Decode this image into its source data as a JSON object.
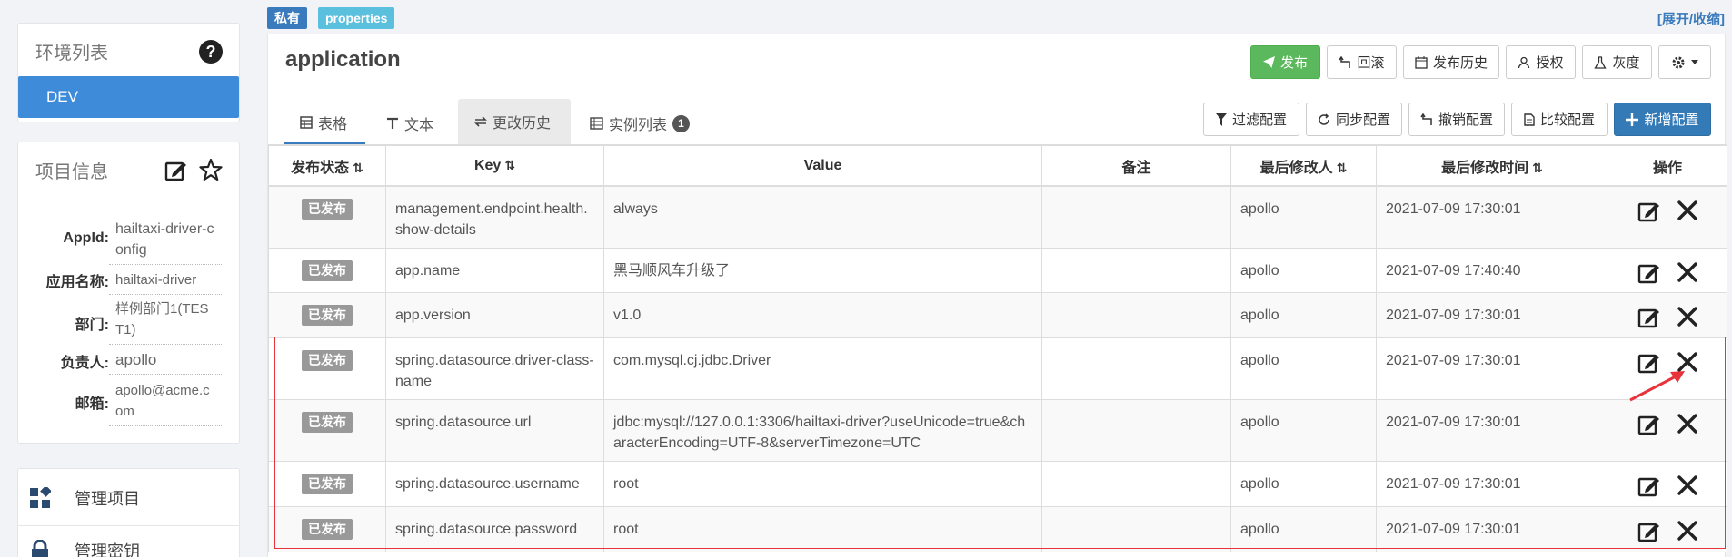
{
  "sidebar": {
    "env_title": "环境列表",
    "env_items": [
      "DEV"
    ],
    "info_title": "项目信息",
    "info": [
      {
        "label": "AppId:",
        "value": "hailtaxi-driver-config"
      },
      {
        "label": "应用名称:",
        "value": "hailtaxi-driver"
      },
      {
        "label": "部门:",
        "value": "样例部门1(TEST1)"
      },
      {
        "label": "负责人:",
        "value": "apollo"
      },
      {
        "label": "邮箱:",
        "value": "apollo@acme.com"
      }
    ],
    "manage": [
      {
        "label": "管理项目",
        "icon": "grid-icon"
      },
      {
        "label": "管理密钥",
        "icon": "lock-icon"
      }
    ]
  },
  "namespace": {
    "tag_private": "私有",
    "tag_format": "properties",
    "expand_label": "[展开/收缩]",
    "title": "application"
  },
  "toolbar": {
    "publish": "发布",
    "rollback": "回滚",
    "history": "发布历史",
    "authorize": "授权",
    "gray": "灰度"
  },
  "tabs": [
    {
      "label": "表格",
      "icon": "table-icon"
    },
    {
      "label": "文本",
      "icon": "text-icon"
    },
    {
      "label": "更改历史",
      "icon": "exchange-icon"
    },
    {
      "label": "实例列表",
      "icon": "list-icon",
      "badge": "1"
    }
  ],
  "actions": {
    "filter": "过滤配置",
    "sync": "同步配置",
    "revoke": "撤销配置",
    "compare": "比较配置",
    "add": "新增配置"
  },
  "table": {
    "headers": [
      "发布状态",
      "Key",
      "Value",
      "备注",
      "最后修改人",
      "最后修改时间",
      "操作"
    ],
    "rows": [
      {
        "status": "已发布",
        "key": "management.endpoint.health.show-details",
        "value": "always",
        "comment": "",
        "modifier": "apollo",
        "time": "2021-07-09 17:30:01"
      },
      {
        "status": "已发布",
        "key": "app.name",
        "value": "黑马顺风车升级了",
        "comment": "",
        "modifier": "apollo",
        "time": "2021-07-09 17:40:40"
      },
      {
        "status": "已发布",
        "key": "app.version",
        "value": "v1.0",
        "comment": "",
        "modifier": "apollo",
        "time": "2021-07-09 17:30:01"
      },
      {
        "status": "已发布",
        "key": "spring.datasource.driver-class-name",
        "value": "com.mysql.cj.jdbc.Driver",
        "comment": "",
        "modifier": "apollo",
        "time": "2021-07-09 17:30:01"
      },
      {
        "status": "已发布",
        "key": "spring.datasource.url",
        "value": "jdbc:mysql://127.0.0.1:3306/hailtaxi-driver?useUnicode=true&characterEncoding=UTF-8&serverTimezone=UTC",
        "comment": "",
        "modifier": "apollo",
        "time": "2021-07-09 17:30:01"
      },
      {
        "status": "已发布",
        "key": "spring.datasource.username",
        "value": "root",
        "comment": "",
        "modifier": "apollo",
        "time": "2021-07-09 17:30:01"
      },
      {
        "status": "已发布",
        "key": "spring.datasource.password",
        "value": "root",
        "comment": "",
        "modifier": "apollo",
        "time": "2021-07-09 17:30:01"
      }
    ]
  },
  "colors": {
    "primary": "#3d8bd9",
    "publish_green": "#5cb85c",
    "add_blue": "#337ab7",
    "highlight_red": "#e8333a",
    "published_badge": "#999999"
  }
}
